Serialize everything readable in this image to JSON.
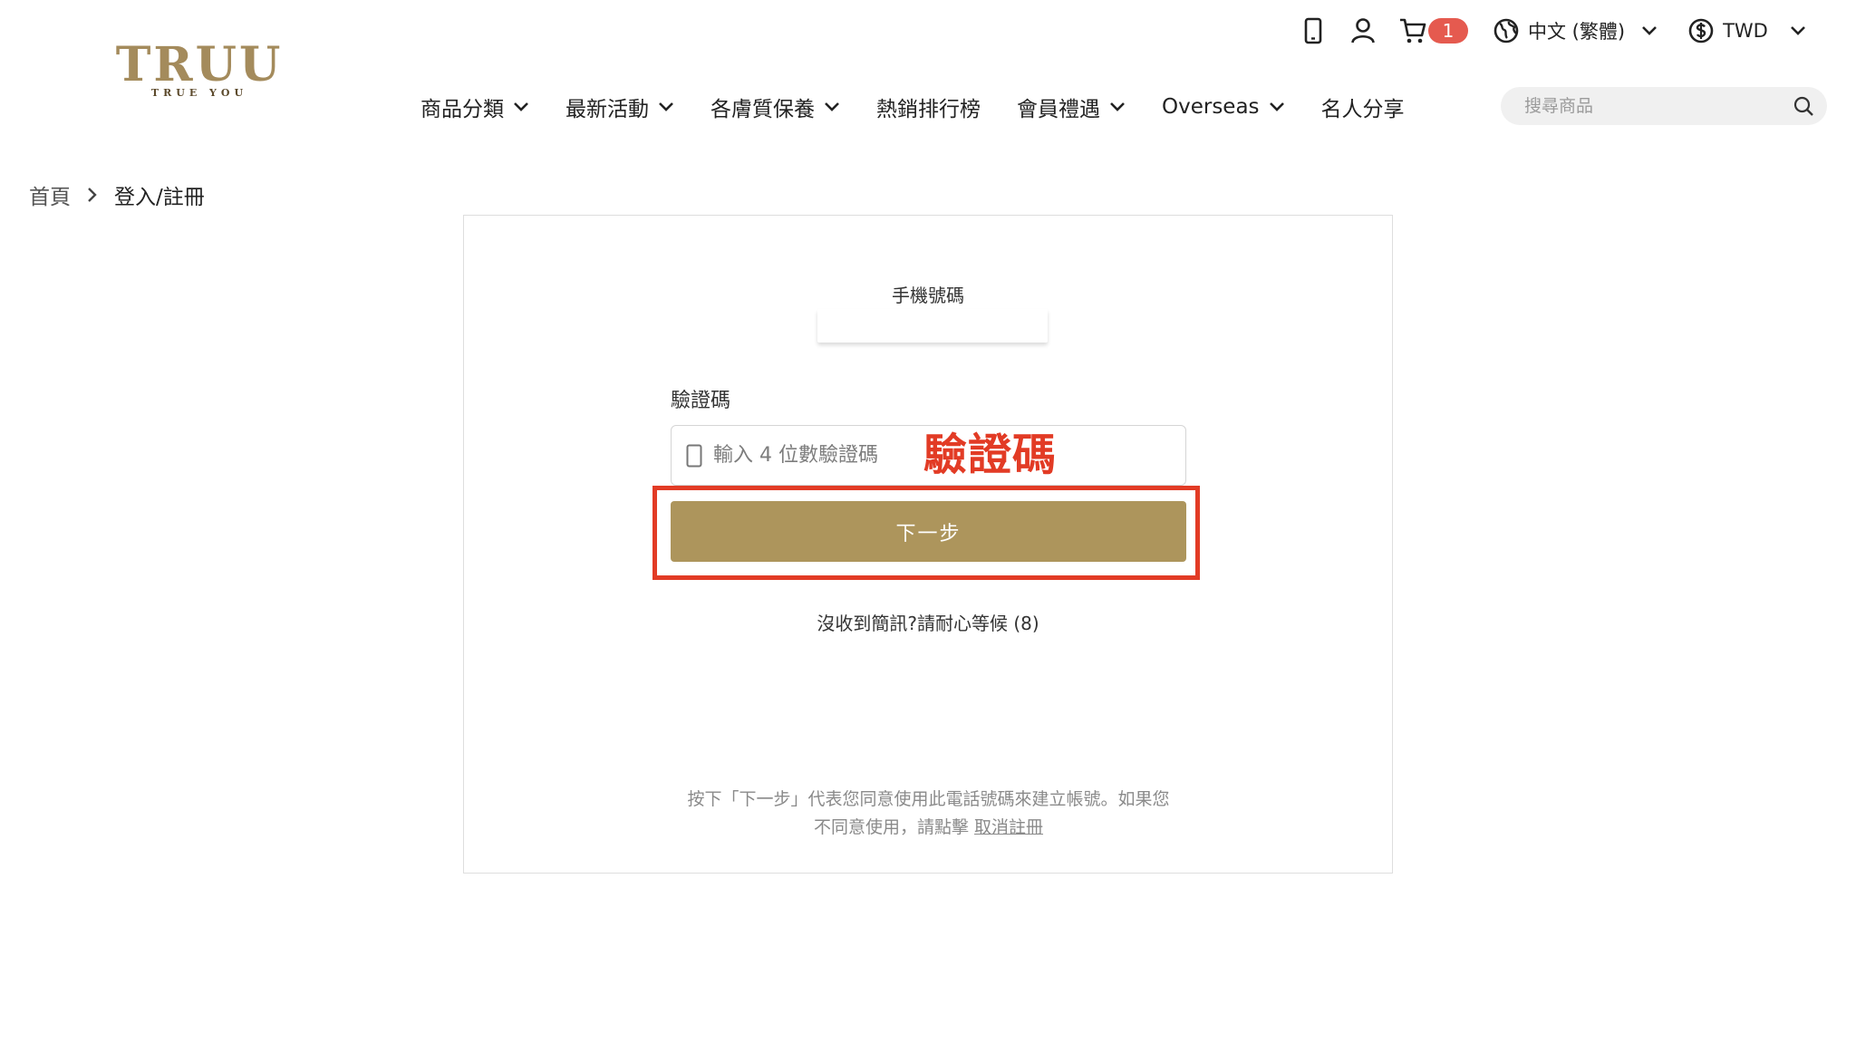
{
  "logo": {
    "main": "TRUU",
    "sub": "TRUE YOU"
  },
  "utility": {
    "cart_count": "1",
    "language": "中文 (繁體)",
    "currency": "TWD"
  },
  "nav": {
    "items": [
      {
        "label": "商品分類",
        "dropdown": true
      },
      {
        "label": "最新活動",
        "dropdown": true
      },
      {
        "label": "各膚質保養",
        "dropdown": true
      },
      {
        "label": "熱銷排行榜",
        "dropdown": false
      },
      {
        "label": "會員禮遇",
        "dropdown": true
      },
      {
        "label": "Overseas",
        "dropdown": true
      },
      {
        "label": "名人分享",
        "dropdown": false
      }
    ]
  },
  "search": {
    "placeholder": "搜尋商品"
  },
  "breadcrumb": {
    "home": "首頁",
    "current": "登入/註冊"
  },
  "form": {
    "phone_label": "手機號碼",
    "code_label": "驗證碼",
    "code_placeholder": "輸入 4 位數驗證碼",
    "annotation": "驗證碼",
    "next_button": "下一步",
    "resend_text": "沒收到簡訊?請耐心等候 (8)",
    "terms_line1": "按下「下一步」代表您同意使用此電話號碼來建立帳號。如果您",
    "terms_line2_prefix": "不同意使用，請點擊 ",
    "terms_cancel": "取消註冊"
  },
  "colors": {
    "brand_gold": "#ad955c",
    "annotation_red": "#e23b25",
    "badge_red": "#e55a4f"
  }
}
